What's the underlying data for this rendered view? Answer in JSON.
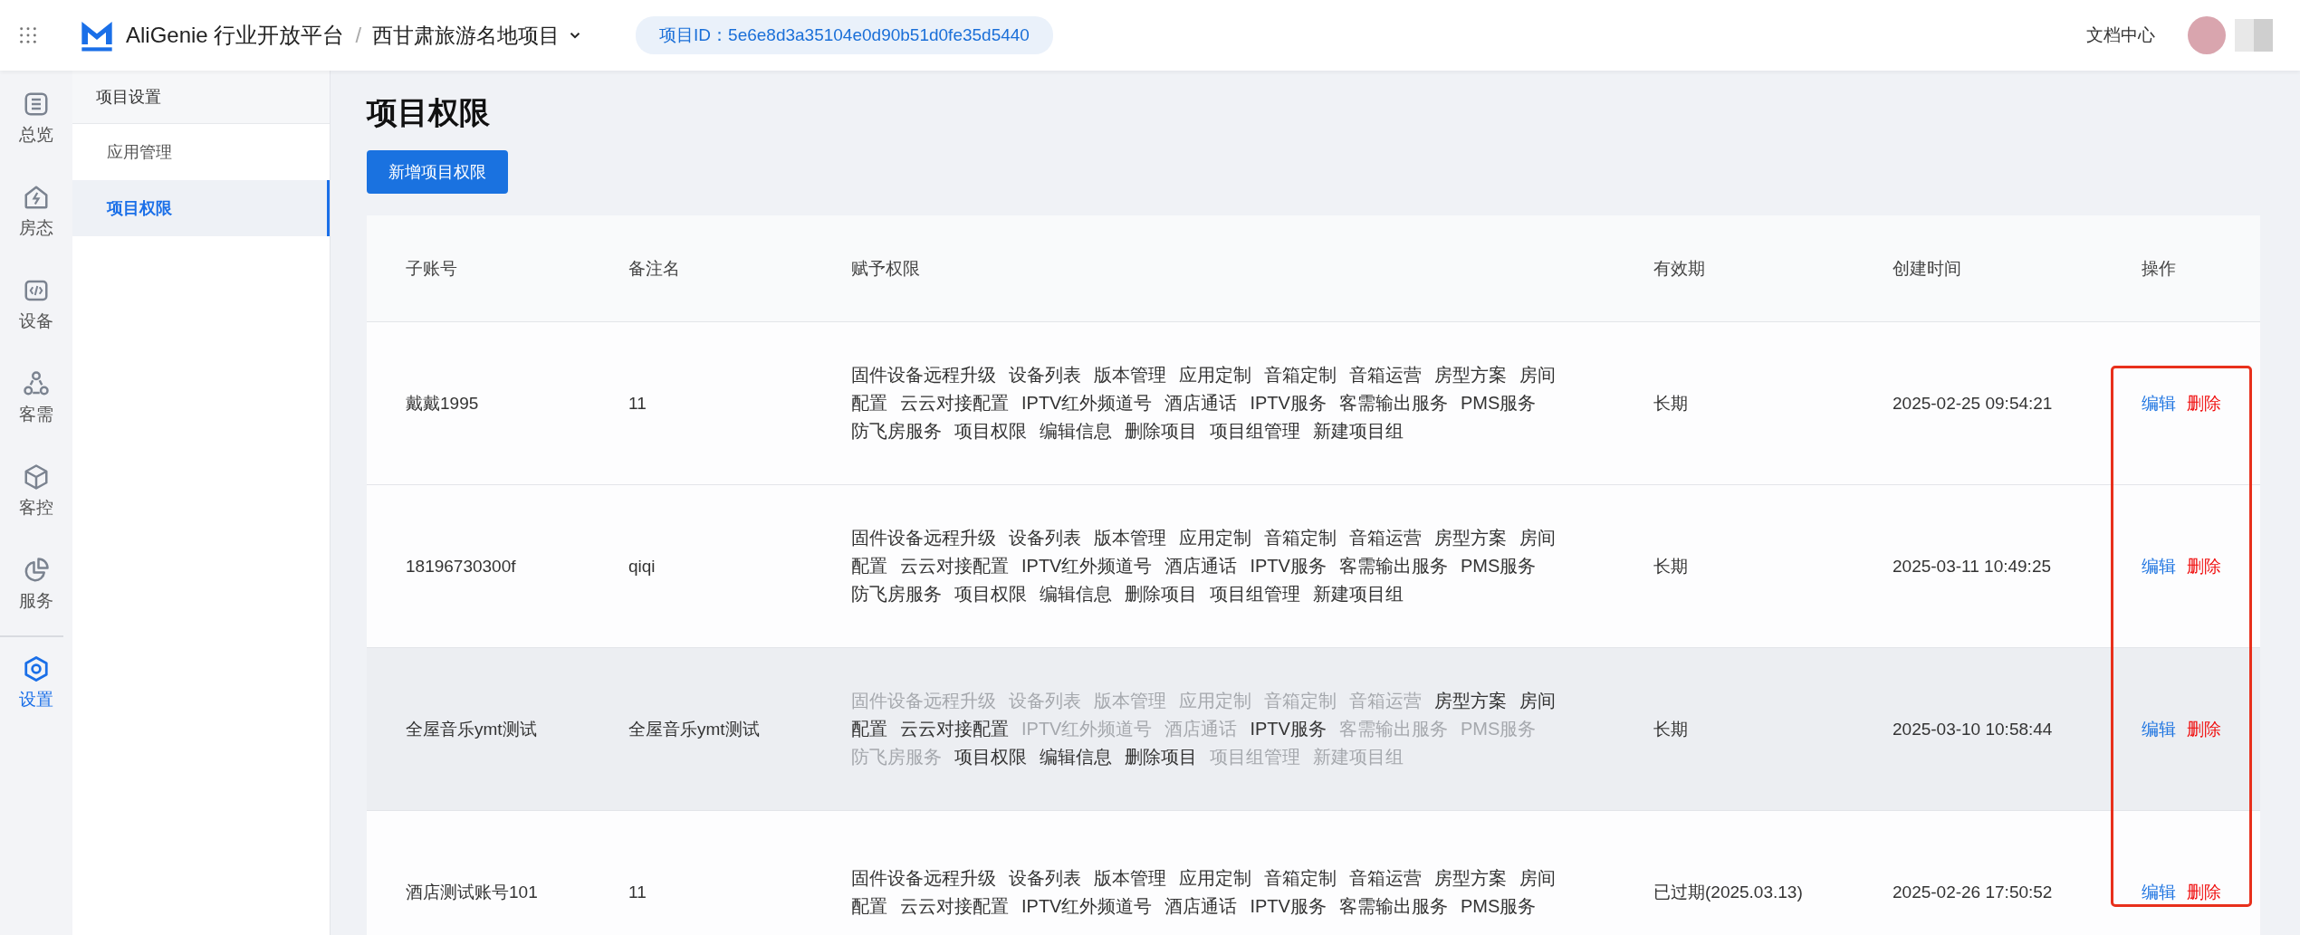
{
  "header": {
    "brand": "AliGenie 行业开放平台",
    "separator": "/",
    "project": "西甘肃旅游名地项目",
    "project_id": "项目ID：5e6e8d3a35104e0d90b51d0fe35d5440",
    "docs_link": "文档中心"
  },
  "rail": [
    {
      "label": "总览",
      "selected": false
    },
    {
      "label": "房态",
      "selected": false
    },
    {
      "label": "设备",
      "selected": false
    },
    {
      "label": "客需",
      "selected": false
    },
    {
      "label": "客控",
      "selected": false
    },
    {
      "label": "服务",
      "selected": false
    },
    {
      "label": "设置",
      "selected": true
    }
  ],
  "submenu": {
    "title": "项目设置",
    "items": [
      {
        "label": "应用管理",
        "selected": false
      },
      {
        "label": "项目权限",
        "selected": true
      }
    ]
  },
  "page_title": "项目权限",
  "add_button": "新增项目权限",
  "table": {
    "columns": [
      "子账号",
      "备注名",
      "赋予权限",
      "有效期",
      "创建时间",
      "操作"
    ],
    "highlight_actions": true,
    "rows": [
      {
        "account": "戴戴1995",
        "remark": "11",
        "validity": "长期",
        "created": "2025-02-25 09:54:21",
        "highlighted": false,
        "actions": [
          "编辑",
          "删除"
        ],
        "permissions": [
          {
            "label": "固件设备远程升级",
            "granted": true
          },
          {
            "label": "设备列表",
            "granted": true
          },
          {
            "label": "版本管理",
            "granted": true
          },
          {
            "label": "应用定制",
            "granted": true
          },
          {
            "label": "音箱定制",
            "granted": true
          },
          {
            "label": "音箱运营",
            "granted": true
          },
          {
            "label": "房型方案",
            "granted": true
          },
          {
            "label": "房间配置",
            "granted": true
          },
          {
            "label": "云云对接配置",
            "granted": true
          },
          {
            "label": "IPTV红外频道号",
            "granted": true
          },
          {
            "label": "酒店通话",
            "granted": true
          },
          {
            "label": "IPTV服务",
            "granted": true
          },
          {
            "label": "客需输出服务",
            "granted": true
          },
          {
            "label": "PMS服务",
            "granted": true
          },
          {
            "label": "防飞房服务",
            "granted": true
          },
          {
            "label": "项目权限",
            "granted": true
          },
          {
            "label": "编辑信息",
            "granted": true
          },
          {
            "label": "删除项目",
            "granted": true
          },
          {
            "label": "项目组管理",
            "granted": true
          },
          {
            "label": "新建项目组",
            "granted": true
          }
        ]
      },
      {
        "account": "18196730300f",
        "remark": "qiqi",
        "validity": "长期",
        "created": "2025-03-11 10:49:25",
        "highlighted": false,
        "actions": [
          "编辑",
          "删除"
        ],
        "permissions": [
          {
            "label": "固件设备远程升级",
            "granted": true
          },
          {
            "label": "设备列表",
            "granted": true
          },
          {
            "label": "版本管理",
            "granted": true
          },
          {
            "label": "应用定制",
            "granted": true
          },
          {
            "label": "音箱定制",
            "granted": true
          },
          {
            "label": "音箱运营",
            "granted": true
          },
          {
            "label": "房型方案",
            "granted": true
          },
          {
            "label": "房间配置",
            "granted": true
          },
          {
            "label": "云云对接配置",
            "granted": true
          },
          {
            "label": "IPTV红外频道号",
            "granted": true
          },
          {
            "label": "酒店通话",
            "granted": true
          },
          {
            "label": "IPTV服务",
            "granted": true
          },
          {
            "label": "客需输出服务",
            "granted": true
          },
          {
            "label": "PMS服务",
            "granted": true
          },
          {
            "label": "防飞房服务",
            "granted": true
          },
          {
            "label": "项目权限",
            "granted": true
          },
          {
            "label": "编辑信息",
            "granted": true
          },
          {
            "label": "删除项目",
            "granted": true
          },
          {
            "label": "项目组管理",
            "granted": true
          },
          {
            "label": "新建项目组",
            "granted": true
          }
        ]
      },
      {
        "account": "全屋音乐ymt测试",
        "remark": "全屋音乐ymt测试",
        "validity": "长期",
        "created": "2025-03-10 10:58:44",
        "highlighted": true,
        "actions": [
          "编辑",
          "删除"
        ],
        "permissions": [
          {
            "label": "固件设备远程升级",
            "granted": false
          },
          {
            "label": "设备列表",
            "granted": false
          },
          {
            "label": "版本管理",
            "granted": false
          },
          {
            "label": "应用定制",
            "granted": false
          },
          {
            "label": "音箱定制",
            "granted": false
          },
          {
            "label": "音箱运营",
            "granted": false
          },
          {
            "label": "房型方案",
            "granted": true
          },
          {
            "label": "房间配置",
            "granted": true
          },
          {
            "label": "云云对接配置",
            "granted": true
          },
          {
            "label": "IPTV红外频道号",
            "granted": false
          },
          {
            "label": "酒店通话",
            "granted": false
          },
          {
            "label": "IPTV服务",
            "granted": true
          },
          {
            "label": "客需输出服务",
            "granted": false
          },
          {
            "label": "PMS服务",
            "granted": false
          },
          {
            "label": "防飞房服务",
            "granted": false
          },
          {
            "label": "项目权限",
            "granted": true
          },
          {
            "label": "编辑信息",
            "granted": true
          },
          {
            "label": "删除项目",
            "granted": true
          },
          {
            "label": "项目组管理",
            "granted": false
          },
          {
            "label": "新建项目组",
            "granted": false
          }
        ]
      },
      {
        "account": "酒店测试账号101",
        "remark": "11",
        "validity": "已过期(2025.03.13)",
        "created": "2025-02-26 17:50:52",
        "highlighted": false,
        "actions": [
          "编辑",
          "删除"
        ],
        "permissions": [
          {
            "label": "固件设备远程升级",
            "granted": true
          },
          {
            "label": "设备列表",
            "granted": true
          },
          {
            "label": "版本管理",
            "granted": true
          },
          {
            "label": "应用定制",
            "granted": true
          },
          {
            "label": "音箱定制",
            "granted": true
          },
          {
            "label": "音箱运营",
            "granted": true
          },
          {
            "label": "房型方案",
            "granted": true
          },
          {
            "label": "房间配置",
            "granted": true
          },
          {
            "label": "云云对接配置",
            "granted": true
          },
          {
            "label": "IPTV红外频道号",
            "granted": true
          },
          {
            "label": "酒店通话",
            "granted": true
          },
          {
            "label": "IPTV服务",
            "granted": true
          },
          {
            "label": "客需输出服务",
            "granted": true
          },
          {
            "label": "PMS服务",
            "granted": true
          }
        ]
      }
    ]
  }
}
